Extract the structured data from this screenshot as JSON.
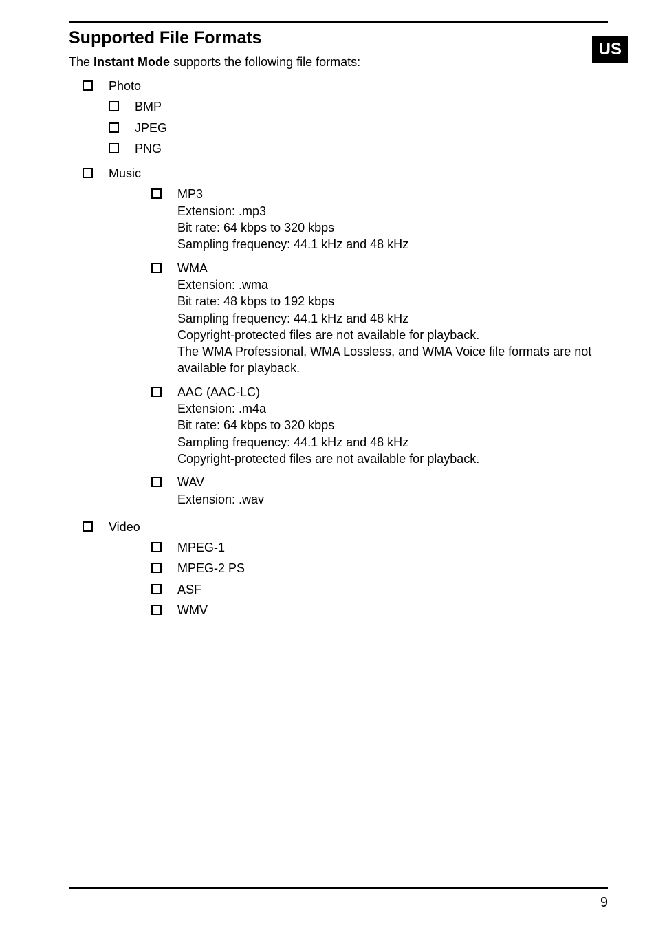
{
  "region": "US",
  "heading": "Supported File Formats",
  "intro_prefix": "The ",
  "intro_bold": "Instant Mode",
  "intro_suffix": " supports the following file formats:",
  "sections": {
    "photo": {
      "label": "Photo",
      "items": {
        "bmp": "BMP",
        "jpeg": "JPEG",
        "png": "PNG"
      }
    },
    "music": {
      "label": "Music",
      "mp3": {
        "label": "MP3",
        "details": [
          "Extension: .mp3",
          "Bit rate: 64 kbps to 320 kbps",
          "Sampling frequency: 44.1 kHz and 48 kHz"
        ]
      },
      "wma": {
        "label": "WMA",
        "details": [
          "Extension: .wma",
          "Bit rate: 48 kbps to 192 kbps",
          "Sampling frequency: 44.1 kHz and 48 kHz",
          "Copyright-protected files are not available for playback.",
          "The WMA Professional, WMA Lossless, and WMA Voice file formats are not available for playback."
        ]
      },
      "aac": {
        "label": "AAC (AAC-LC)",
        "details": [
          "Extension: .m4a",
          "Bit rate: 64 kbps to 320 kbps",
          "Sampling frequency: 44.1 kHz and 48 kHz",
          "Copyright-protected files are not available for playback."
        ]
      },
      "wav": {
        "label": "WAV",
        "details": [
          "Extension: .wav"
        ]
      }
    },
    "video": {
      "label": "Video",
      "items": {
        "mpeg1": "MPEG-1",
        "mpeg2ps": "MPEG-2 PS",
        "asf": "ASF",
        "wmv": "WMV"
      }
    }
  },
  "page_number": "9"
}
